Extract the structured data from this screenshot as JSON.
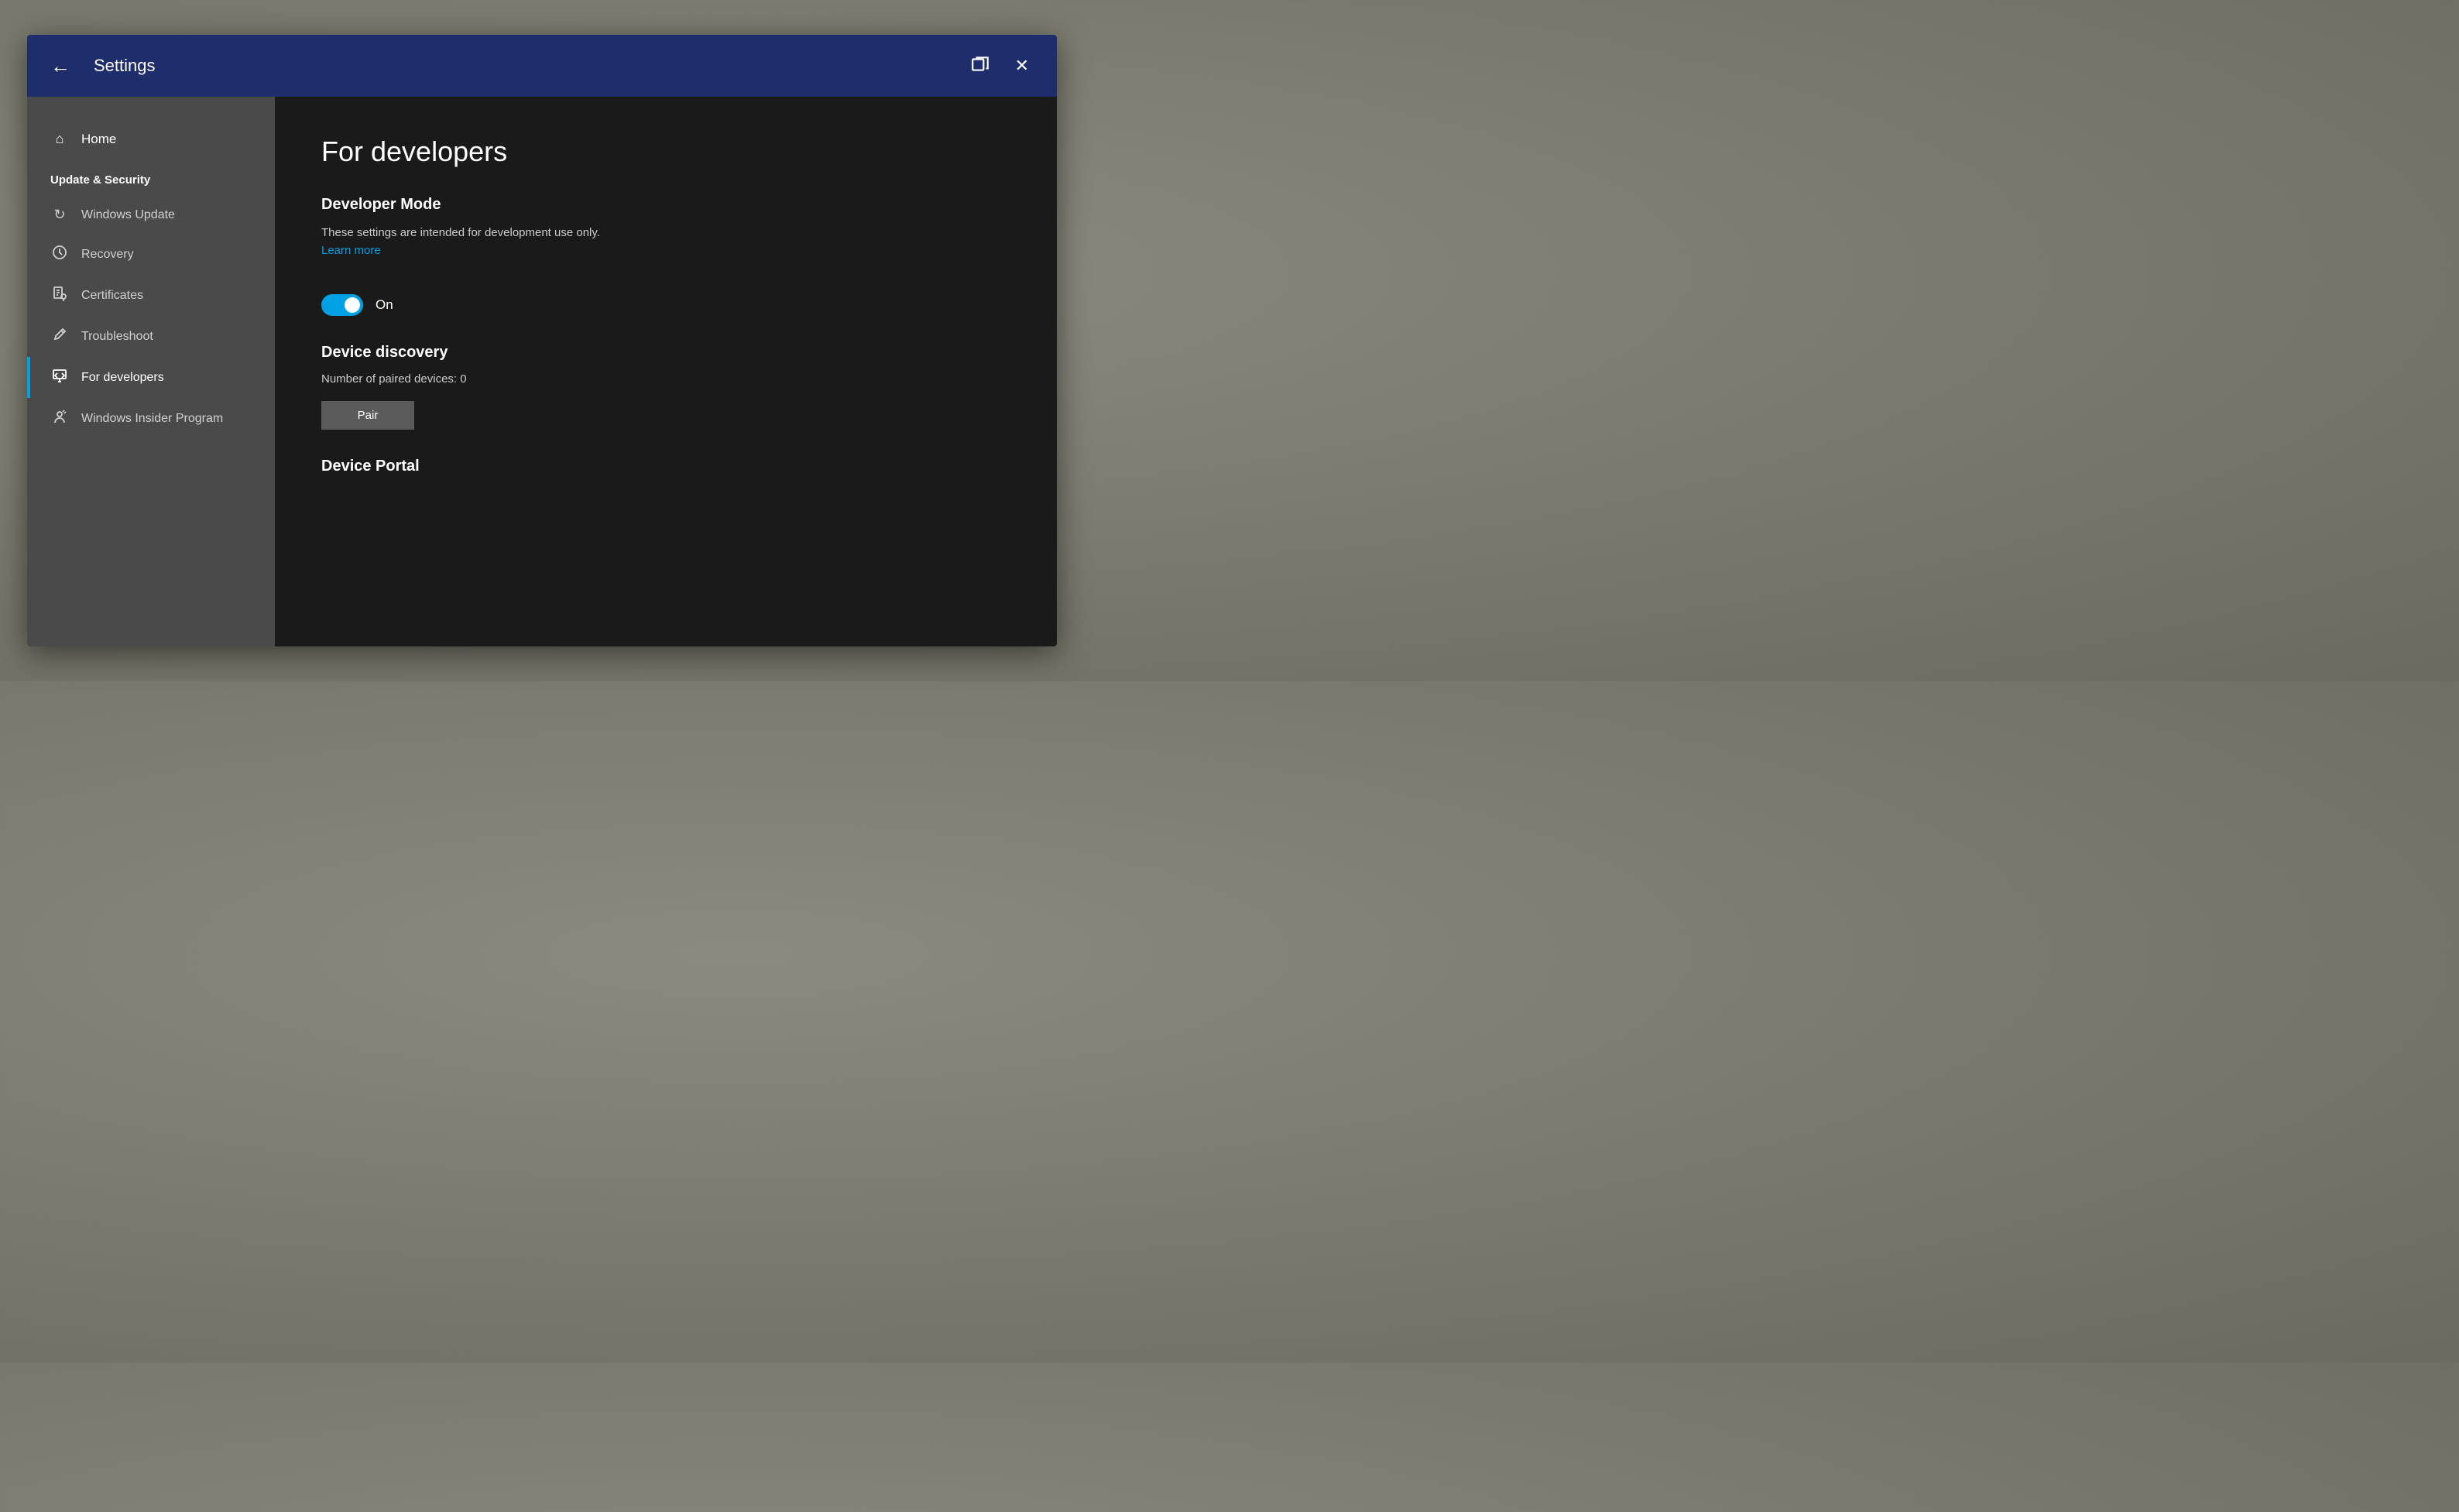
{
  "titleBar": {
    "title": "Settings",
    "backLabel": "←",
    "closeLabel": "✕"
  },
  "sidebar": {
    "homeLabel": "Home",
    "sectionLabel": "Update & Security",
    "items": [
      {
        "id": "windows-update",
        "label": "Windows Update",
        "icon": "↻",
        "active": false
      },
      {
        "id": "recovery",
        "label": "Recovery",
        "icon": "⟳",
        "active": false
      },
      {
        "id": "certificates",
        "label": "Certificates",
        "icon": "📄",
        "active": false
      },
      {
        "id": "troubleshoot",
        "label": "Troubleshoot",
        "icon": "🔧",
        "active": false
      },
      {
        "id": "for-developers",
        "label": "For developers",
        "icon": "⧉",
        "active": true
      },
      {
        "id": "windows-insider",
        "label": "Windows Insider Program",
        "icon": "👤",
        "active": false
      }
    ]
  },
  "content": {
    "title": "For developers",
    "developerMode": {
      "heading": "Developer Mode",
      "description": "These settings are intended for development use only.",
      "learnMore": "Learn more",
      "toggleState": "On"
    },
    "deviceDiscovery": {
      "heading": "Device discovery",
      "pairedDevicesText": "Number of paired devices: 0",
      "pairButton": "Pair"
    },
    "devicePortal": {
      "heading": "Device Portal"
    }
  }
}
